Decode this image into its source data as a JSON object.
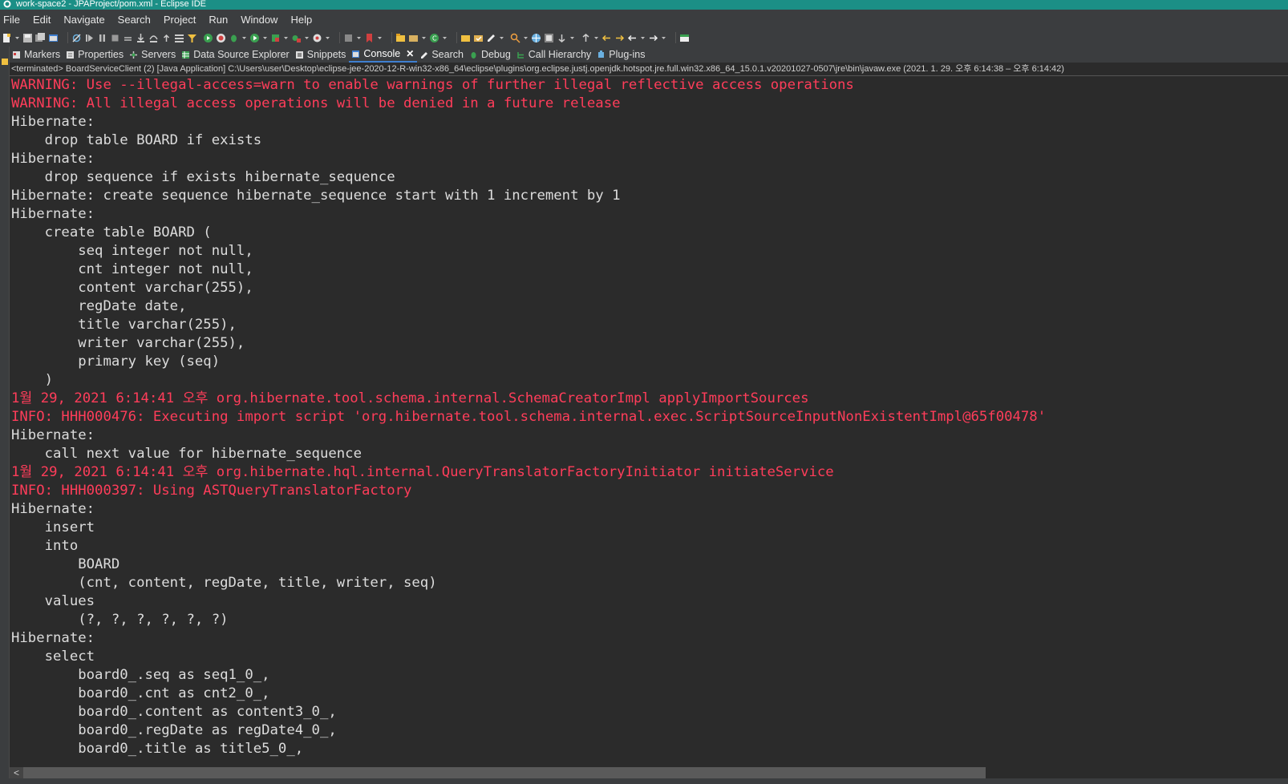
{
  "window": {
    "title": "work-space2 - JPAProject/pom.xml - Eclipse IDE"
  },
  "menu": [
    "File",
    "Edit",
    "Navigate",
    "Search",
    "Project",
    "Run",
    "Window",
    "Help"
  ],
  "tabs": [
    {
      "label": "Markers",
      "icon": "markers-icon",
      "active": false
    },
    {
      "label": "Properties",
      "icon": "properties-icon",
      "active": false
    },
    {
      "label": "Servers",
      "icon": "servers-icon",
      "active": false
    },
    {
      "label": "Data Source Explorer",
      "icon": "data-source-icon",
      "active": false
    },
    {
      "label": "Snippets",
      "icon": "snippets-icon",
      "active": false
    },
    {
      "label": "Console",
      "icon": "console-icon",
      "active": true
    },
    {
      "label": "Search",
      "icon": "search-icon",
      "active": false
    },
    {
      "label": "Debug",
      "icon": "debug-icon",
      "active": false
    },
    {
      "label": "Call Hierarchy",
      "icon": "call-hierarchy-icon",
      "active": false
    },
    {
      "label": "Plug-ins",
      "icon": "plugins-icon",
      "active": false
    }
  ],
  "console": {
    "status": "<terminated> BoardServiceClient (2) [Java Application] C:\\Users\\user\\Desktop\\eclipse-jee-2020-12-R-win32-x86_64\\eclipse\\plugins\\org.eclipse.justj.openjdk.hotspot.jre.full.win32.x86_64_15.0.1.v20201027-0507\\jre\\bin\\javaw.exe  (2021. 1. 29. 오후 6:14:38 – 오후 6:14:42)",
    "lines": [
      {
        "text": "WARNING: Use --illegal-access=warn to enable warnings of further illegal reflective access operations",
        "err": true
      },
      {
        "text": "WARNING: All illegal access operations will be denied in a future release",
        "err": true
      },
      {
        "text": "Hibernate: ",
        "err": false
      },
      {
        "text": "    drop table BOARD if exists",
        "err": false
      },
      {
        "text": "Hibernate: ",
        "err": false
      },
      {
        "text": "    drop sequence if exists hibernate_sequence",
        "err": false
      },
      {
        "text": "Hibernate: create sequence hibernate_sequence start with 1 increment by 1",
        "err": false
      },
      {
        "text": "Hibernate: ",
        "err": false
      },
      {
        "text": "    create table BOARD (",
        "err": false
      },
      {
        "text": "        seq integer not null,",
        "err": false
      },
      {
        "text": "        cnt integer not null,",
        "err": false
      },
      {
        "text": "        content varchar(255),",
        "err": false
      },
      {
        "text": "        regDate date,",
        "err": false
      },
      {
        "text": "        title varchar(255),",
        "err": false
      },
      {
        "text": "        writer varchar(255),",
        "err": false
      },
      {
        "text": "        primary key (seq)",
        "err": false
      },
      {
        "text": "    )",
        "err": false
      },
      {
        "text": "1월 29, 2021 6:14:41 오후 org.hibernate.tool.schema.internal.SchemaCreatorImpl applyImportSources",
        "err": true
      },
      {
        "text": "INFO: HHH000476: Executing import script 'org.hibernate.tool.schema.internal.exec.ScriptSourceInputNonExistentImpl@65f00478'",
        "err": true
      },
      {
        "text": "Hibernate: ",
        "err": false
      },
      {
        "text": "    call next value for hibernate_sequence",
        "err": false
      },
      {
        "text": "1월 29, 2021 6:14:41 오후 org.hibernate.hql.internal.QueryTranslatorFactoryInitiator initiateService",
        "err": true
      },
      {
        "text": "INFO: HHH000397: Using ASTQueryTranslatorFactory",
        "err": true
      },
      {
        "text": "Hibernate: ",
        "err": false
      },
      {
        "text": "    insert ",
        "err": false
      },
      {
        "text": "    into",
        "err": false
      },
      {
        "text": "        BOARD",
        "err": false
      },
      {
        "text": "        (cnt, content, regDate, title, writer, seq) ",
        "err": false
      },
      {
        "text": "    values",
        "err": false
      },
      {
        "text": "        (?, ?, ?, ?, ?, ?)",
        "err": false
      },
      {
        "text": "Hibernate: ",
        "err": false
      },
      {
        "text": "    select",
        "err": false
      },
      {
        "text": "        board0_.seq as seq1_0_,",
        "err": false
      },
      {
        "text": "        board0_.cnt as cnt2_0_,",
        "err": false
      },
      {
        "text": "        board0_.content as content3_0_,",
        "err": false
      },
      {
        "text": "        board0_.regDate as regDate4_0_,",
        "err": false
      },
      {
        "text": "        board0_.title as title5_0_,",
        "err": false
      }
    ]
  },
  "colors": {
    "titlebar": "#1b8f86",
    "console_bg": "#2b2b2b",
    "error_text": "#ff3d5a",
    "normal_text": "#dcdcdc",
    "active_tab_underline": "#3f7fd0"
  },
  "scroll": {
    "left_arrow": "<"
  }
}
